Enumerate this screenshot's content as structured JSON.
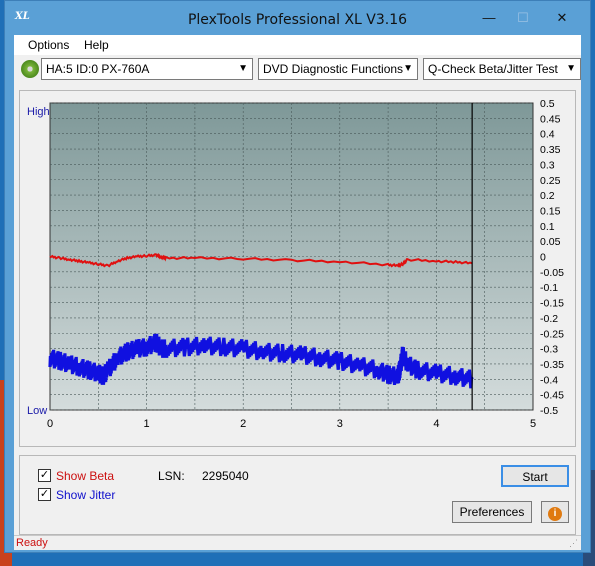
{
  "window": {
    "title": "PlexTools Professional XL V3.16",
    "app_icon_text": "XL",
    "buttons": {
      "minimize": "—",
      "maximize": "☐",
      "close": "✕"
    }
  },
  "menu": {
    "options": "Options",
    "help": "Help"
  },
  "toolbar": {
    "drive": "HA:5 ID:0  PX-760A",
    "function": "DVD Diagnostic Functions",
    "test": "Q-Check Beta/Jitter Test",
    "drive_icon": "disc-icon"
  },
  "chart_labels": {
    "high": "High",
    "low": "Low"
  },
  "chart_data": {
    "type": "line",
    "x_ticks": [
      "0",
      "1",
      "2",
      "3",
      "4",
      "5"
    ],
    "xlim": [
      0,
      5
    ],
    "y_ticks": [
      "0.5",
      "0.45",
      "0.4",
      "0.35",
      "0.3",
      "0.25",
      "0.2",
      "0.15",
      "0.1",
      "0.05",
      "0",
      "-0.05",
      "-0.1",
      "-0.15",
      "-0.2",
      "-0.25",
      "-0.3",
      "-0.35",
      "-0.4",
      "-0.45",
      "-0.5"
    ],
    "ylim": [
      -0.5,
      0.5
    ],
    "grid": true,
    "cursor_x": 4.37,
    "series": [
      {
        "color": "#e01010",
        "points": [
          [
            0,
            0.0
          ],
          [
            0.1,
            -0.005
          ],
          [
            0.2,
            -0.01
          ],
          [
            0.3,
            -0.015
          ],
          [
            0.4,
            -0.02
          ],
          [
            0.5,
            -0.025
          ],
          [
            0.6,
            -0.03
          ],
          [
            0.7,
            -0.015
          ],
          [
            0.8,
            -0.005
          ],
          [
            0.9,
            0.0
          ],
          [
            1.0,
            0.002
          ],
          [
            1.1,
            0.005
          ],
          [
            1.15,
            -0.002
          ],
          [
            1.2,
            -0.005
          ],
          [
            1.5,
            -0.005
          ],
          [
            2.0,
            -0.007
          ],
          [
            2.5,
            -0.012
          ],
          [
            3.0,
            -0.017
          ],
          [
            3.5,
            -0.027
          ],
          [
            3.6,
            -0.03
          ],
          [
            3.65,
            -0.025
          ],
          [
            3.7,
            -0.01
          ],
          [
            4.0,
            -0.015
          ],
          [
            4.2,
            -0.018
          ],
          [
            4.37,
            -0.022
          ]
        ]
      },
      {
        "color": "#1010e0",
        "points": [
          [
            0,
            -0.33
          ],
          [
            0.1,
            -0.34
          ],
          [
            0.2,
            -0.35
          ],
          [
            0.3,
            -0.36
          ],
          [
            0.4,
            -0.37
          ],
          [
            0.5,
            -0.38
          ],
          [
            0.55,
            -0.39
          ],
          [
            0.6,
            -0.37
          ],
          [
            0.7,
            -0.33
          ],
          [
            0.8,
            -0.31
          ],
          [
            0.9,
            -0.3
          ],
          [
            1.0,
            -0.295
          ],
          [
            1.1,
            -0.28
          ],
          [
            1.15,
            -0.3
          ],
          [
            1.2,
            -0.3
          ],
          [
            1.4,
            -0.295
          ],
          [
            1.6,
            -0.29
          ],
          [
            1.8,
            -0.295
          ],
          [
            2.0,
            -0.3
          ],
          [
            2.2,
            -0.31
          ],
          [
            2.4,
            -0.315
          ],
          [
            2.6,
            -0.32
          ],
          [
            2.8,
            -0.33
          ],
          [
            3.0,
            -0.34
          ],
          [
            3.2,
            -0.355
          ],
          [
            3.4,
            -0.37
          ],
          [
            3.5,
            -0.385
          ],
          [
            3.6,
            -0.39
          ],
          [
            3.62,
            -0.37
          ],
          [
            3.65,
            -0.32
          ],
          [
            3.7,
            -0.35
          ],
          [
            3.8,
            -0.37
          ],
          [
            4.0,
            -0.38
          ],
          [
            4.2,
            -0.39
          ],
          [
            4.37,
            -0.4
          ]
        ]
      }
    ]
  },
  "options": {
    "show_beta": "Show Beta",
    "show_jitter": "Show Jitter",
    "show_beta_checked": "✓",
    "show_jitter_checked": "✓",
    "lsn_label": "LSN:",
    "lsn_value": "2295040"
  },
  "buttons": {
    "start": "Start",
    "preferences": "Preferences",
    "info_icon": "info-icon",
    "info_glyph": "i"
  },
  "status": {
    "text": "Ready"
  }
}
